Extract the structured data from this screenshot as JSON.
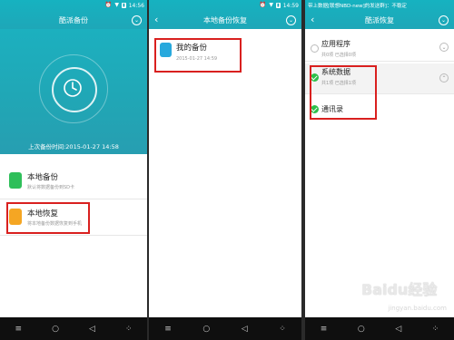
{
  "panel1": {
    "status_time": "14:56",
    "title": "酷派备份",
    "last_backup": "上次备份时间:2015-01-27 14:58",
    "items": [
      {
        "title": "本地备份",
        "subtitle": "默认将数据备份到SD卡"
      },
      {
        "title": "本地恢复",
        "subtitle": "将本地备份数据恢复到手机"
      }
    ]
  },
  "panel2": {
    "status_time": "14:59",
    "title": "本地备份恢复",
    "record": {
      "title": "我的备份",
      "date": "2015-01-27 14:59"
    }
  },
  "panel3": {
    "status_text": "带上数据[联想NBD-new]的发送群]：不稳定",
    "title": "酷派恢复",
    "rows": [
      {
        "title": "应用程序",
        "subtitle": "共0项 已选择0项",
        "checked": false
      },
      {
        "title": "系统数据",
        "subtitle": "共1项 已选择1项",
        "checked": true
      },
      {
        "title": "通讯录",
        "subtitle": "",
        "checked": true
      }
    ]
  },
  "nav": {
    "menu": "≡",
    "home": "○",
    "back": "◁",
    "extra": "⁘"
  },
  "watermark": {
    "brand": "Baidu经验",
    "site": "jingyan.baidu.com"
  },
  "colors": {
    "teal": "#18aebd",
    "highlight": "#d9201f",
    "check": "#2dbf4a"
  }
}
